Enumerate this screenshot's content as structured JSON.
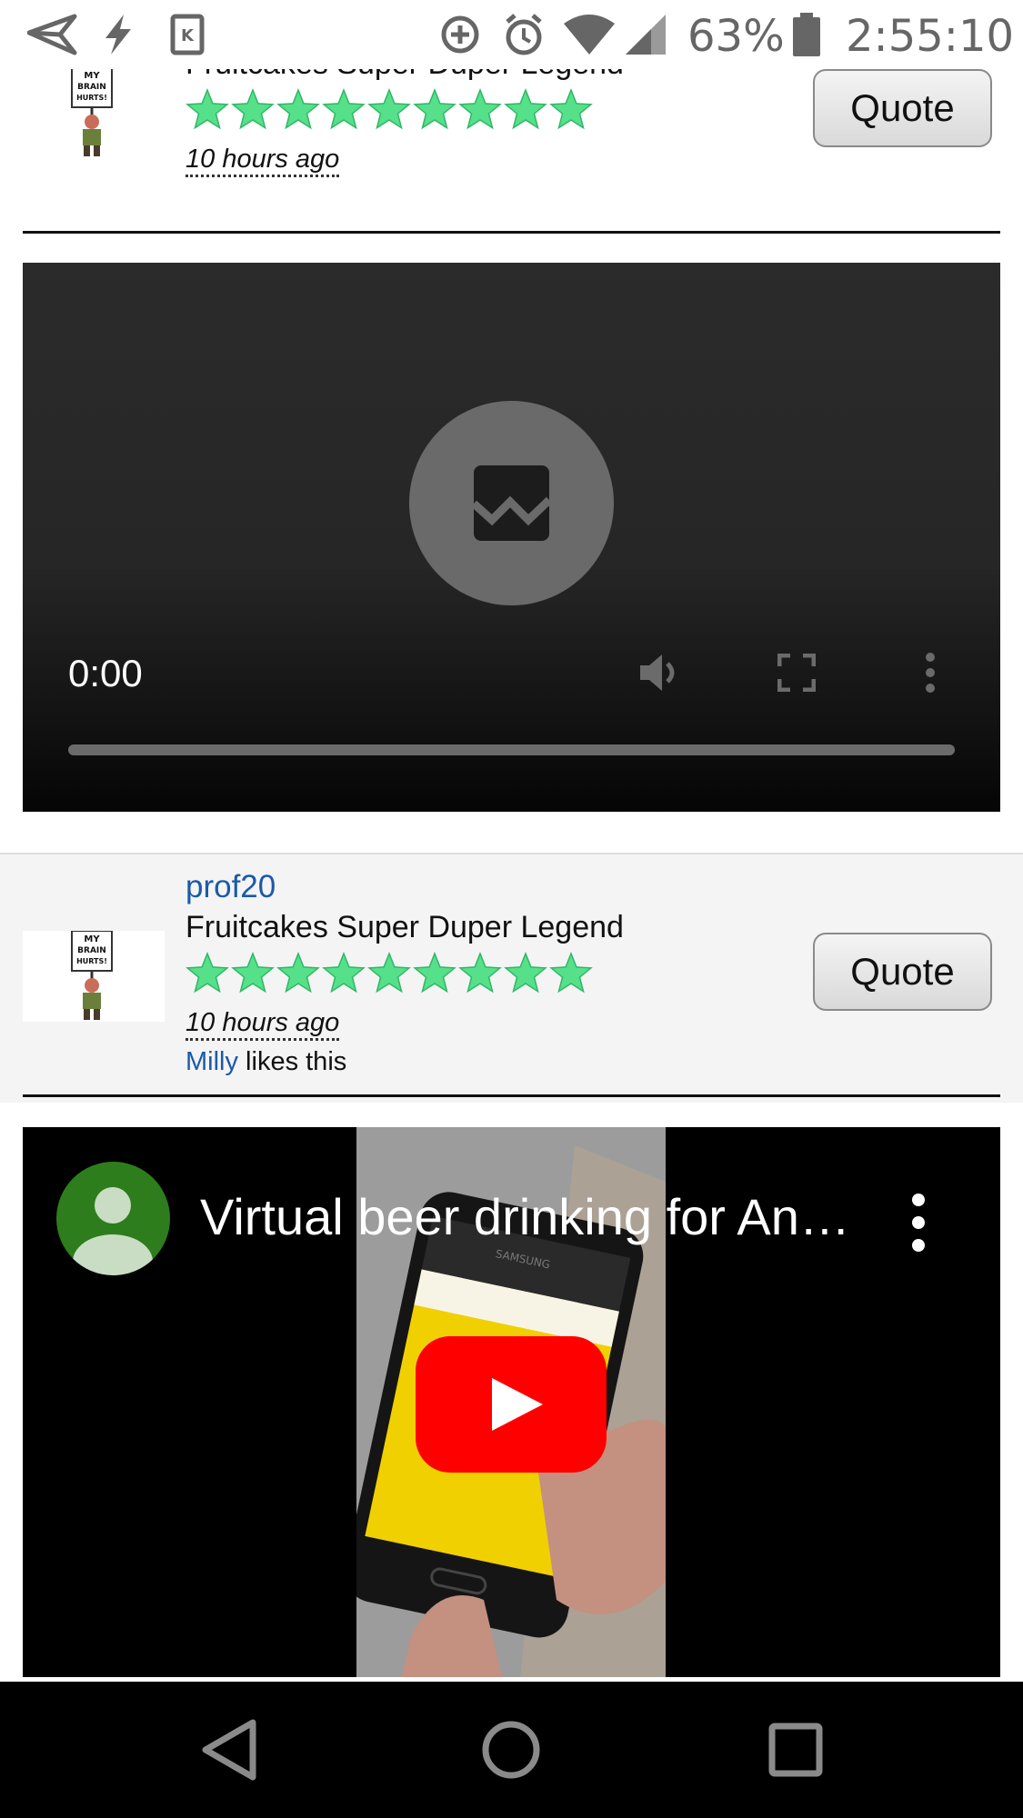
{
  "status_bar": {
    "battery": "63%",
    "time": "2:55:10"
  },
  "post1": {
    "rank": "Fruitcakes Super Duper Legend",
    "time_ago": "10 hours ago",
    "quote_label": "Quote",
    "avatar_text": "MY BRAIN HURTS!",
    "star_count": 9
  },
  "video_player": {
    "current_time": "0:00",
    "progress": 0
  },
  "post2": {
    "username": "prof20",
    "rank": "Fruitcakes Super Duper Legend",
    "time_ago": "10 hours ago",
    "quote_label": "Quote",
    "liker": "Milly",
    "likes_suffix": " likes this",
    "avatar_text": "MY BRAIN HURTS!",
    "star_count": 9
  },
  "youtube_embed": {
    "title": "Virtual beer drinking for An…",
    "phone_brand": "SAMSUNG"
  },
  "colors": {
    "link": "#1a5aa8",
    "star": "#56e08a",
    "youtube_red": "#ff0000",
    "avatar_green": "#2e7d1c"
  }
}
